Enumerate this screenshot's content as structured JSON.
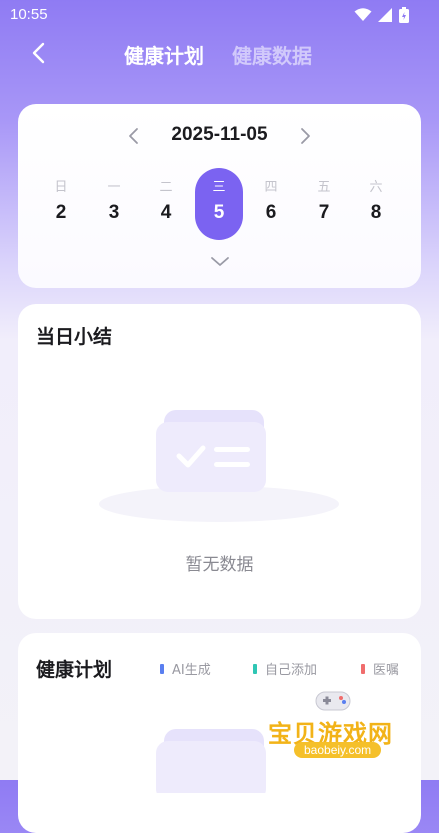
{
  "status_bar": {
    "time": "10:55"
  },
  "header": {
    "tabs": [
      {
        "label": "健康计划",
        "active": true
      },
      {
        "label": "健康数据",
        "active": false
      }
    ]
  },
  "calendar": {
    "date": "2025-11-05",
    "days": [
      {
        "weekday": "日",
        "num": "2",
        "selected": false
      },
      {
        "weekday": "一",
        "num": "3",
        "selected": false
      },
      {
        "weekday": "二",
        "num": "4",
        "selected": false
      },
      {
        "weekday": "三",
        "num": "5",
        "selected": true
      },
      {
        "weekday": "四",
        "num": "6",
        "selected": false
      },
      {
        "weekday": "五",
        "num": "7",
        "selected": false
      },
      {
        "weekday": "六",
        "num": "8",
        "selected": false
      }
    ]
  },
  "summary": {
    "title": "当日小结",
    "empty_text": "暂无数据"
  },
  "plan": {
    "title": "健康计划",
    "legend": [
      {
        "label": "AI生成",
        "color": "#5a7ff0"
      },
      {
        "label": "自己添加",
        "color": "#2fc6b4"
      },
      {
        "label": "医嘱",
        "color": "#f06d6d"
      }
    ]
  },
  "watermark": {
    "title": "宝贝游戏网",
    "subtitle": "baobeiy.com"
  },
  "colors": {
    "accent": "#7b63f1",
    "gradient_top": "#8f7bf3"
  }
}
